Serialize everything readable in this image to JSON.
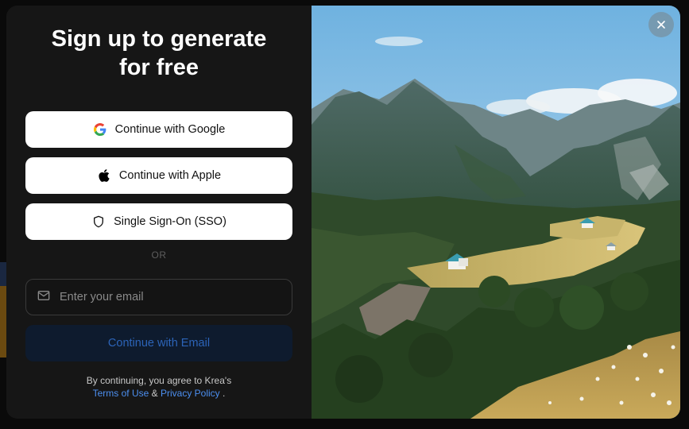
{
  "modal": {
    "title_line1": "Sign up to generate",
    "title_line2": "for free",
    "google_label": "Continue with Google",
    "apple_label": "Continue with Apple",
    "sso_label": "Single Sign-On (SSO)",
    "or_label": "OR",
    "email_placeholder": "Enter your email",
    "email_button_label": "Continue with Email",
    "terms_prefix": "By continuing, you agree to Krea's",
    "terms_link": "Terms of Use",
    "terms_and": "&",
    "privacy_link": "Privacy Policy",
    "terms_suffix": "."
  },
  "icons": {
    "google": "google-icon",
    "apple": "apple-icon",
    "sso": "shield-icon",
    "email": "mail-icon",
    "close": "close-icon"
  },
  "colors": {
    "panel_bg": "#161616",
    "email_button_bg": "#0e1b2e",
    "email_button_text": "#2c64b8",
    "link": "#4c8ff0"
  }
}
